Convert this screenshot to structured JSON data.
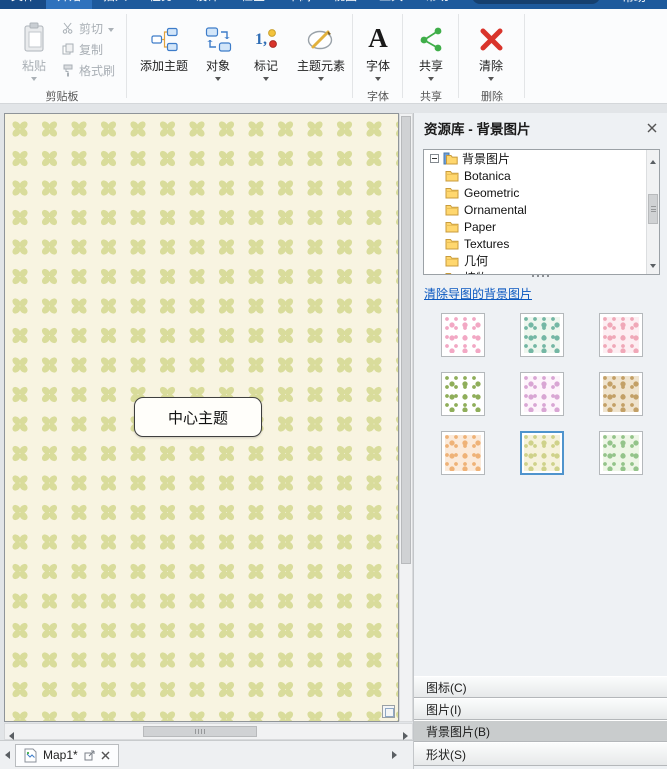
{
  "tabbar": {
    "tabs": [
      "文件",
      "开始",
      "插入",
      "任务",
      "设计",
      "检查",
      "审阅",
      "视图",
      "工具",
      "帮助"
    ],
    "active_tab": "开始",
    "right_label": "帮助"
  },
  "ribbon": {
    "paste": "粘贴",
    "cut": "剪切",
    "copy": "复制",
    "format_painter": "格式刷",
    "add_topic": "添加主题",
    "object": "对象",
    "mark": "标记",
    "topic_elements": "主题元素",
    "font": "字体",
    "share": "共享",
    "clear": "清除",
    "group_clipboard": "剪贴板",
    "group_font": "字体",
    "group_share": "共享",
    "group_delete": "删除"
  },
  "canvas": {
    "central_topic": "中心主题"
  },
  "panel": {
    "title": "资源库 - 背景图片",
    "tree_root": "背景图片",
    "tree_items": [
      "Botanica",
      "Geometric",
      "Ornamental",
      "Paper",
      "Textures",
      "几何",
      "植物"
    ],
    "clear_link": "清除导图的背景图片",
    "thumbnails": [
      {
        "name": "pink-flowers",
        "bg": "#ffffff",
        "fg": "#f2a8c4",
        "selected": false
      },
      {
        "name": "teal-leaves",
        "bg": "#eef6ee",
        "fg": "#74b7a4",
        "selected": false
      },
      {
        "name": "pink-roses",
        "bg": "#fdeef2",
        "fg": "#f0a8b8",
        "selected": false
      },
      {
        "name": "green-branch",
        "bg": "#ffffff",
        "fg": "#8fae5a",
        "selected": false
      },
      {
        "name": "purple-flowers",
        "bg": "#fdf4fb",
        "fg": "#d9a6d4",
        "selected": false
      },
      {
        "name": "tan-leaves",
        "bg": "#efe3cd",
        "fg": "#c3a066",
        "selected": false
      },
      {
        "name": "orange-flowers",
        "bg": "#fbeada",
        "fg": "#efb277",
        "selected": false
      },
      {
        "name": "green-clovers",
        "bg": "#f6f2dc",
        "fg": "#cfd28a",
        "selected": true
      },
      {
        "name": "green-floral",
        "bg": "#eef6e6",
        "fg": "#94c48a",
        "selected": false
      }
    ],
    "bottom_tabs": [
      {
        "label": "图标(C)",
        "selected": false
      },
      {
        "label": "图片(I)",
        "selected": false
      },
      {
        "label": "背景图片(B)",
        "selected": true
      },
      {
        "label": "形状(S)",
        "selected": false
      }
    ]
  },
  "statusbar": {
    "doc_tab": "Map1*"
  },
  "colors": {
    "accent": "#2f72bd",
    "selection": "#4f94cd",
    "link": "#0a58c0",
    "clover": "#d9dc9b",
    "canvas_bg": "#f8f4e1"
  }
}
